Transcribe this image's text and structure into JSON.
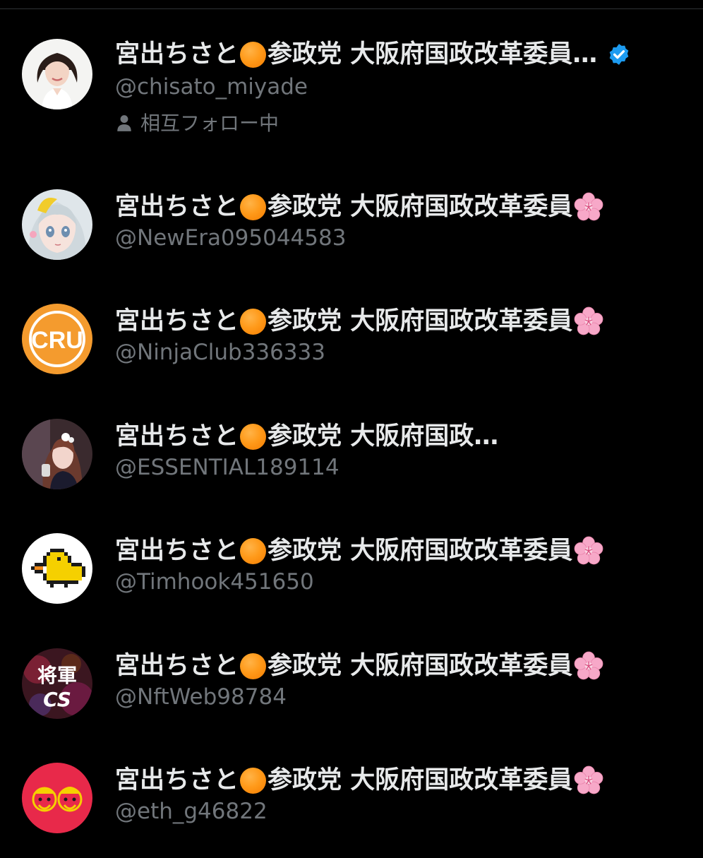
{
  "colors": {
    "background": "#000000",
    "name_text": "#e7e9ea",
    "secondary_text": "#71767b",
    "verified_blue": "#1d9bf0",
    "orange_dot": "#ff9a1a",
    "flower_pink": "#f7a8c8"
  },
  "accounts": [
    {
      "name_part1": "宮出ちさと",
      "name_part2": "参政党 大阪府国政改革委員…",
      "handle": "@chisato_miyade",
      "verified": true,
      "follow_status": "相互フォロー中",
      "avatar_icon": "woman-portrait-avatar"
    },
    {
      "name_part1": "宮出ちさと",
      "name_part2": "参政党 大阪府国政改革委員",
      "handle": "@NewEra095044583",
      "avatar_icon": "anime-girl-avatar"
    },
    {
      "name_part1": "宮出ちさと",
      "name_part2": "参政党 大阪府国政改革委員",
      "handle": "@NinjaClub336333",
      "avatar_icon": "cru-logo-avatar",
      "avatar_text": "CRU"
    },
    {
      "name_part1": "宮出ちさと",
      "name_part2": "参政党 大阪府国政…",
      "handle": "@ESSENTIAL189114",
      "avatar_icon": "woman-photo-avatar"
    },
    {
      "name_part1": "宮出ちさと",
      "name_part2": "参政党 大阪府国政改革委員",
      "handle": "@Timhook451650",
      "avatar_icon": "pixel-chick-avatar"
    },
    {
      "name_part1": "宮出ちさと",
      "name_part2": "参政党 大阪府国政改革委員",
      "handle": "@NftWeb98784",
      "avatar_icon": "shogun-cs-avatar",
      "avatar_text_top": "将軍",
      "avatar_text_bottom": "CS"
    },
    {
      "name_part1": "宮出ちさと",
      "name_part2": "参政党 大阪府国政改革委員",
      "handle": "@eth_g46822",
      "avatar_icon": "cartoon-faces-avatar"
    }
  ]
}
